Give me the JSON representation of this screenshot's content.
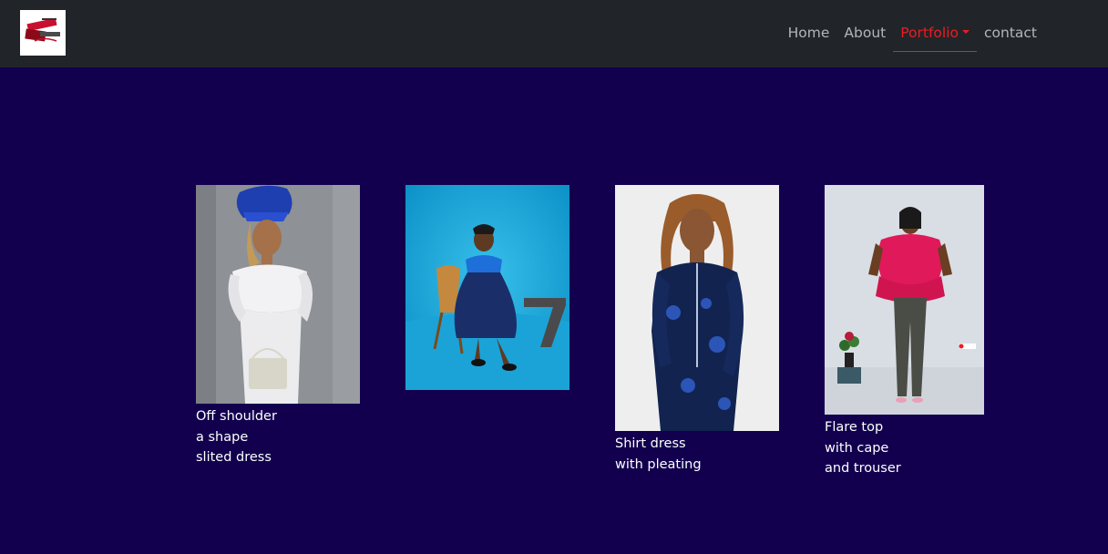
{
  "navbar": {
    "logo_icon": "brand-logo",
    "items": [
      {
        "label": "Home",
        "active": false
      },
      {
        "label": "About",
        "active": false
      },
      {
        "label": "Portfolio",
        "active": true,
        "dropdown": true
      },
      {
        "label": "contact",
        "active": false
      }
    ]
  },
  "colors": {
    "page_background": "#12004e",
    "navbar_background": "#212529",
    "accent": "#ec1c24",
    "nav_text": "#b3b5b8"
  },
  "portfolio": [
    {
      "image": "woman-in-white-off-shoulder-dress-with-blue-headwrap",
      "caption": [
        "Off shoulder",
        "a shape",
        "slited dress"
      ]
    },
    {
      "image": "girl-in-blue-dress-seated-on-chair-with-number-7",
      "caption": []
    },
    {
      "image": "woman-in-navy-blue-shirt-dress",
      "caption": [
        "Shirt dress",
        "with pleating"
      ]
    },
    {
      "image": "woman-in-pink-flare-top-and-grey-trousers",
      "caption": [
        "Flare top",
        "with cape",
        "and trouser"
      ]
    }
  ]
}
